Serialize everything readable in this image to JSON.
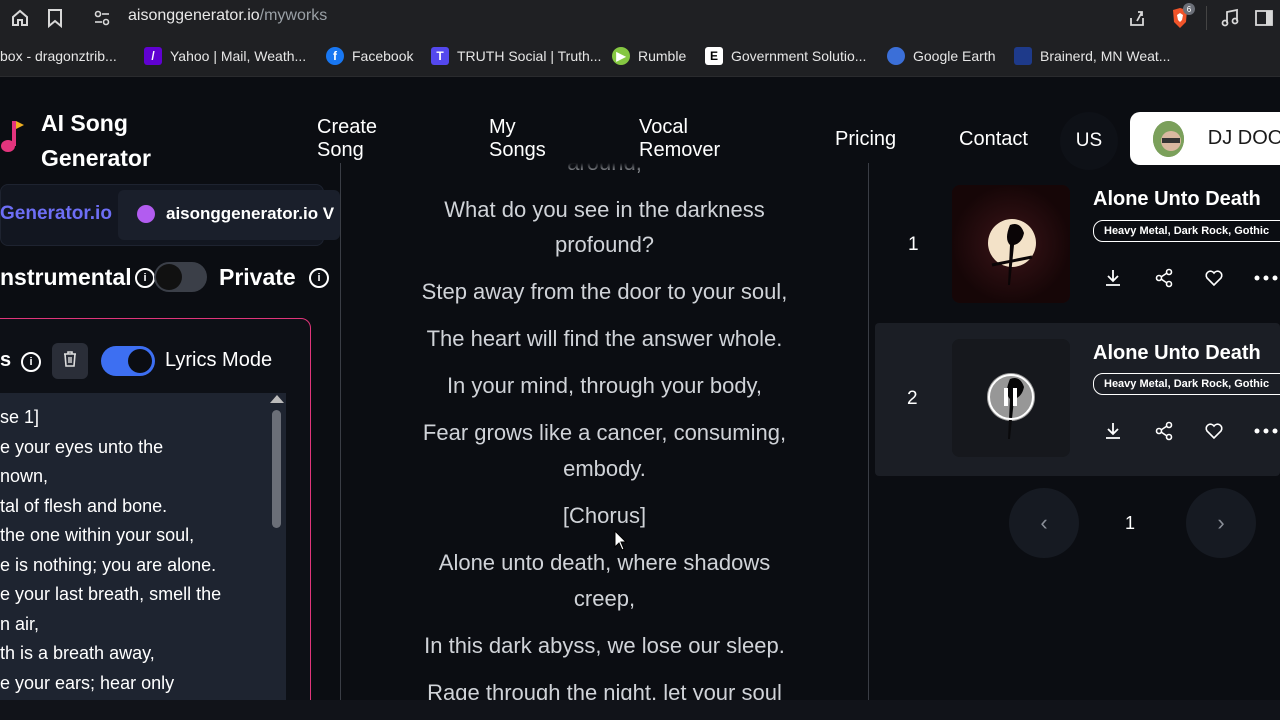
{
  "browser": {
    "url_host": "aisonggenerator.io",
    "url_path": "/myworks",
    "ext_badge": "6",
    "bookmarks": [
      {
        "label": "box - dragonztrib...",
        "icon": "mail-icon"
      },
      {
        "label": "Yahoo | Mail, Weath...",
        "icon": "yahoo-icon"
      },
      {
        "label": "Facebook",
        "icon": "facebook-icon"
      },
      {
        "label": "TRUTH Social | Truth...",
        "icon": "truth-icon"
      },
      {
        "label": "Rumble",
        "icon": "rumble-icon"
      },
      {
        "label": "Government Solutio...",
        "icon": "gov-icon"
      },
      {
        "label": "Google Earth",
        "icon": "earth-icon"
      },
      {
        "label": "Brainerd, MN Weat...",
        "icon": "weather-icon"
      }
    ]
  },
  "header": {
    "logo_line1": "AI Song",
    "logo_line2": "Generator",
    "nav": {
      "create_1": "Create",
      "create_2": "Song",
      "mysongs_1": "My",
      "mysongs_2": "Songs",
      "vocal_1": "Vocal",
      "vocal_2": "Remover",
      "pricing": "Pricing",
      "contact": "Contact"
    },
    "lang": "US",
    "user_name": "DJ DOOM"
  },
  "left": {
    "tab_brand": "Generator.io",
    "tab_other": "aisonggenerator.io V",
    "instrumental_label": "nstrumental",
    "private_label": "Private",
    "lyrics_label": "s",
    "lyrics_mode_label": "Lyrics Mode",
    "lyrics_lines": [
      "se 1]",
      "e your eyes unto the",
      "nown,",
      "tal of flesh and bone.",
      " the one within your soul,",
      "e is nothing; you are alone.",
      "e your last breath, smell the",
      "n air,",
      "th is a breath away,",
      "e your ears; hear only"
    ]
  },
  "center": {
    "lines": [
      "around,",
      "What do you see in the darkness",
      "profound?",
      "Step away from the door to your soul,",
      "The heart will find the answer whole.",
      "In your mind, through your body,",
      "Fear grows like a cancer, consuming,",
      "embody.",
      "[Chorus]",
      "Alone unto death, where shadows",
      "creep,",
      "In this dark abyss, we lose our sleep.",
      "Rage through the night, let your soul"
    ]
  },
  "songs": [
    {
      "index": "1",
      "title": "Alone Unto Death",
      "tags": "Heavy Metal, Dark Rock, Gothic"
    },
    {
      "index": "2",
      "title": "Alone Unto Death",
      "tags": "Heavy Metal, Dark Rock, Gothic"
    }
  ],
  "pagination": {
    "current": "1"
  }
}
